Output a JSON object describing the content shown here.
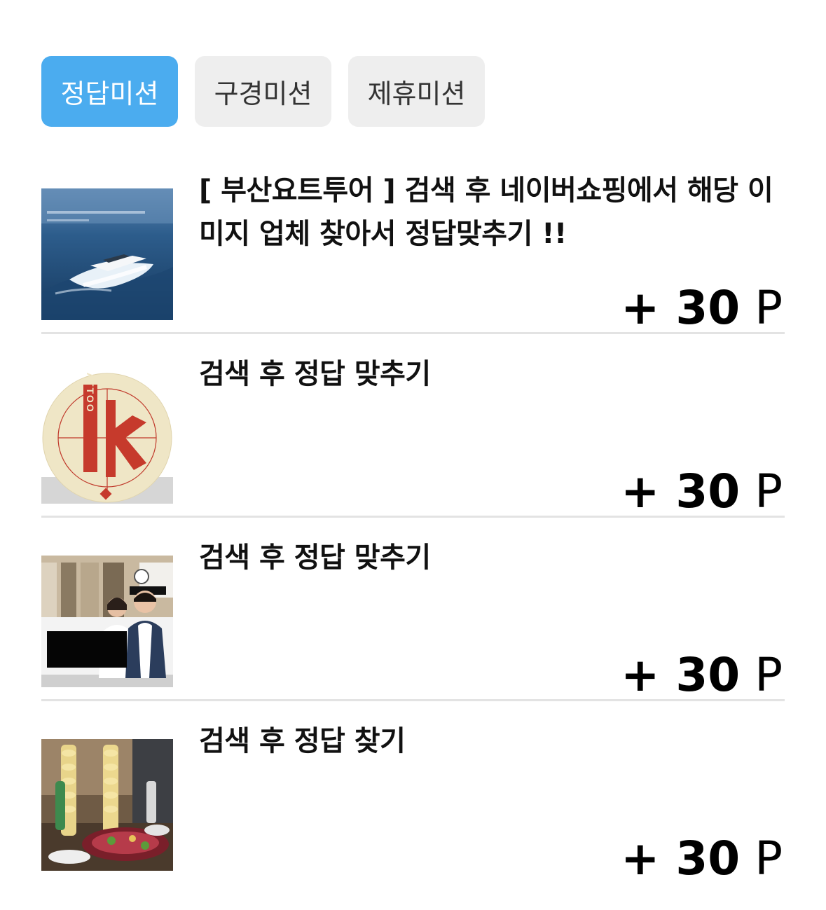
{
  "tabs": [
    {
      "label": "정답미션",
      "active": true
    },
    {
      "label": "구경미션",
      "active": false
    },
    {
      "label": "제휴미션",
      "active": false
    }
  ],
  "missions": [
    {
      "title": "[ 부산요트투어 ] 검색 후 네이버쇼핑에서 해당 이미지 업체 찾아서 정답맞추기 !!",
      "points_value": "+ 30",
      "points_unit": "P",
      "thumbnail": "yacht-image"
    },
    {
      "title": "검색 후 정답 맞추기",
      "points_value": "+ 30",
      "points_unit": "P",
      "thumbnail": "tattoo-logo-image",
      "thumbnail_logo_text": "TATTOO"
    },
    {
      "title": "검색 후 정답 맞추기",
      "points_value": "+ 30",
      "points_unit": "P",
      "thumbnail": "clinic-doctors-image"
    },
    {
      "title": "검색 후 정답 찾기",
      "points_value": "+ 30",
      "points_unit": "P",
      "thumbnail": "restaurant-food-image"
    }
  ],
  "colors": {
    "active_tab": "#4bacef",
    "inactive_tab": "#eeeeee",
    "divider": "#e3e3e3"
  }
}
